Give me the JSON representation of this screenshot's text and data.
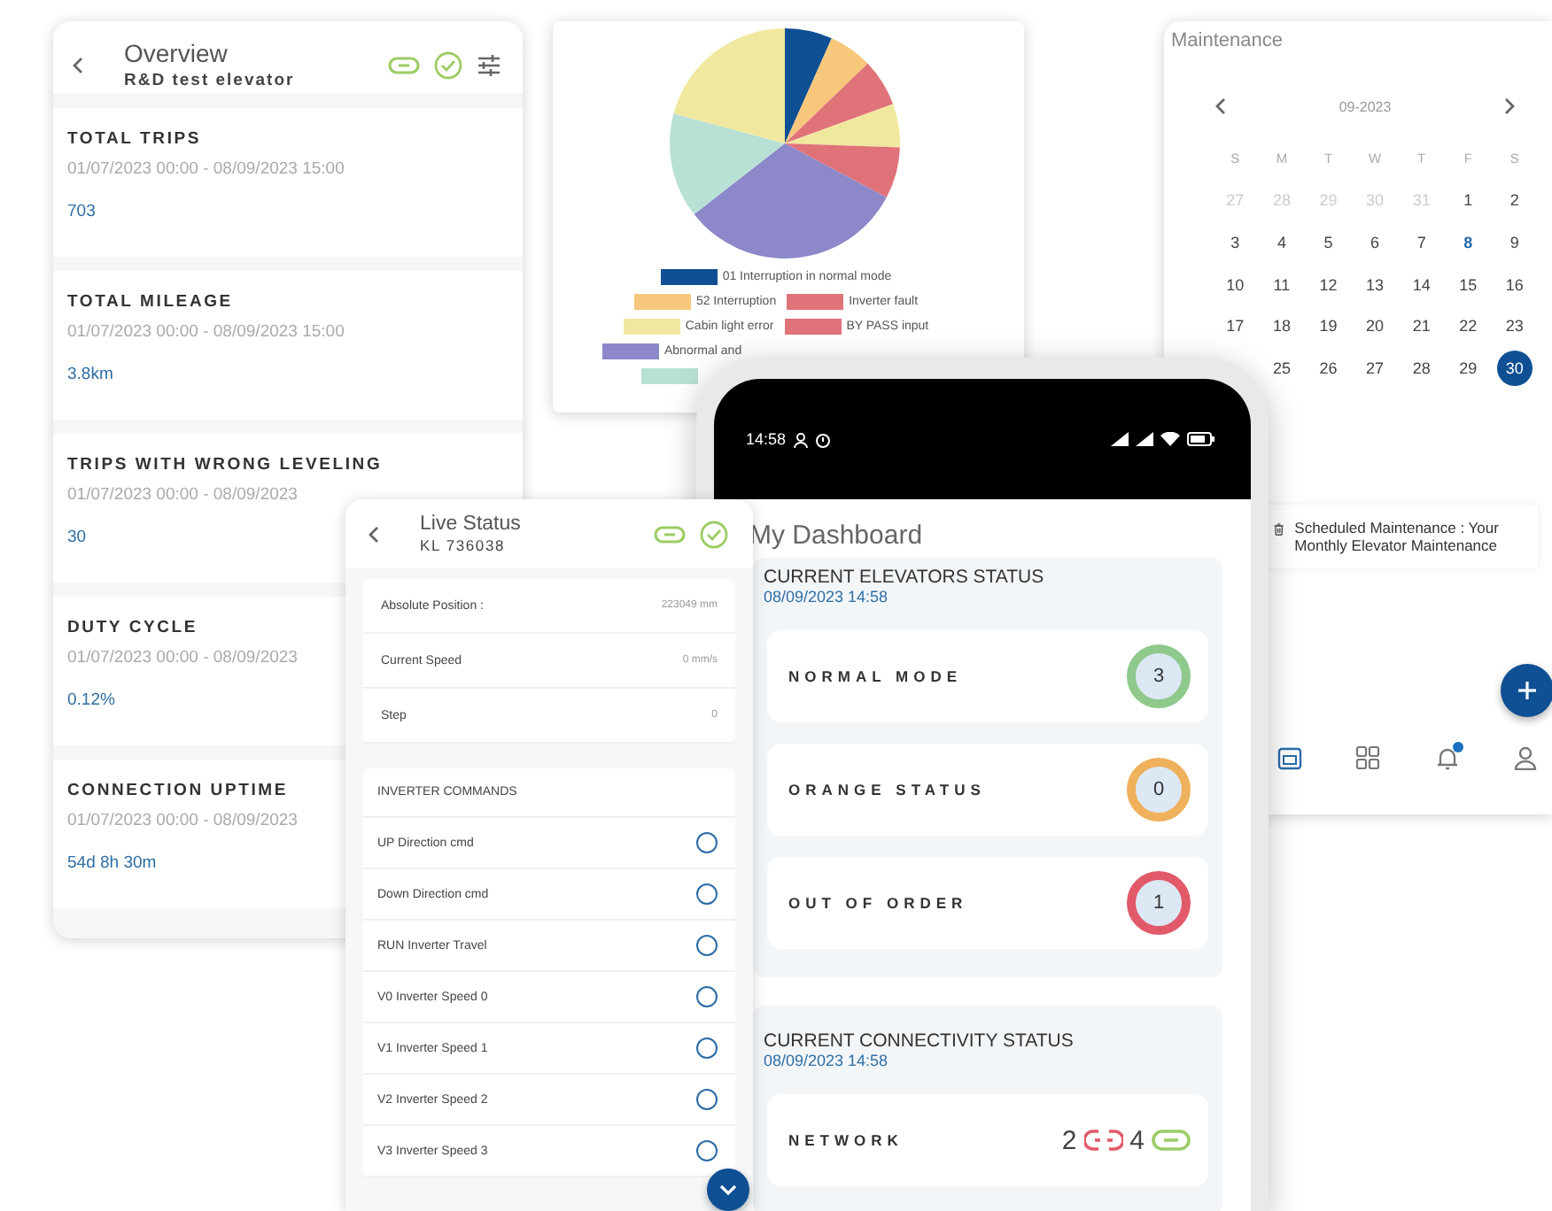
{
  "overview": {
    "title": "Overview",
    "subtitle": "R&D test elevator",
    "metrics": [
      {
        "label": "TOTAL TRIPS",
        "period": "01/07/2023 00:00 - 08/09/2023 15:00",
        "value": "703"
      },
      {
        "label": "TOTAL MILEAGE",
        "period": "01/07/2023 00:00 - 08/09/2023 15:00",
        "value": "3.8km"
      },
      {
        "label": "TRIPS WITH WRONG LEVELING",
        "period": "01/07/2023 00:00 - 08/09/2023",
        "value": "30"
      },
      {
        "label": "DUTY CYCLE",
        "period": "01/07/2023 00:00 - 08/09/2023",
        "value": "0.12%"
      },
      {
        "label": "CONNECTION UPTIME",
        "period": "01/07/2023 00:00 - 08/09/2023",
        "value": "54d 8h 30m"
      }
    ]
  },
  "fault_chart": {
    "legend": [
      {
        "label": "01 Interruption in normal mode",
        "color": "#0f4f93"
      },
      {
        "label": "52 Interruption",
        "color": "#f7c77c"
      },
      {
        "label": "Inverter fault",
        "color": "#e0737a"
      },
      {
        "label": "Cabin light error",
        "color": "#f1e8a0"
      },
      {
        "label": "BY PASS input",
        "color": "#e0737a"
      },
      {
        "label": "Abnormal and",
        "color": "#8c88c9"
      },
      {
        "color": "#b9e0d5"
      }
    ]
  },
  "maintenance": {
    "title": "Maintenance",
    "month": "09-2023",
    "weekdays": [
      "S",
      "M",
      "T",
      "W",
      "T",
      "F",
      "S"
    ],
    "weeks": [
      [
        {
          "day": "27",
          "kind": "outside",
          "selected": false
        },
        {
          "day": "28",
          "kind": "outside",
          "selected": false
        },
        {
          "day": "29",
          "kind": "outside",
          "selected": false
        },
        {
          "day": "30",
          "kind": "outside",
          "selected": false
        },
        {
          "day": "31",
          "kind": "outside",
          "selected": false
        },
        {
          "day": "1",
          "kind": "day",
          "selected": false
        },
        {
          "day": "2",
          "kind": "day",
          "selected": false
        }
      ],
      [
        {
          "day": "3",
          "kind": "day",
          "selected": false
        },
        {
          "day": "4",
          "kind": "day",
          "selected": false
        },
        {
          "day": "5",
          "kind": "day",
          "selected": false
        },
        {
          "day": "6",
          "kind": "day",
          "selected": false
        },
        {
          "day": "7",
          "kind": "day",
          "selected": false
        },
        {
          "day": "8",
          "kind": "event",
          "selected": false
        },
        {
          "day": "9",
          "kind": "day",
          "selected": false
        }
      ],
      [
        {
          "day": "10",
          "kind": "day",
          "selected": false
        },
        {
          "day": "11",
          "kind": "day",
          "selected": false
        },
        {
          "day": "12",
          "kind": "day",
          "selected": false
        },
        {
          "day": "13",
          "kind": "day",
          "selected": false
        },
        {
          "day": "14",
          "kind": "day",
          "selected": false
        },
        {
          "day": "15",
          "kind": "day",
          "selected": false
        },
        {
          "day": "16",
          "kind": "day",
          "selected": false
        }
      ],
      [
        {
          "day": "17",
          "kind": "day",
          "selected": false
        },
        {
          "day": "18",
          "kind": "day",
          "selected": false
        },
        {
          "day": "19",
          "kind": "day",
          "selected": false
        },
        {
          "day": "20",
          "kind": "day",
          "selected": false
        },
        {
          "day": "21",
          "kind": "day",
          "selected": false
        },
        {
          "day": "22",
          "kind": "day",
          "selected": false
        },
        {
          "day": "23",
          "kind": "day",
          "selected": false
        }
      ],
      [
        {
          "day": "25",
          "kind": "day",
          "selected": false
        },
        {
          "day": "26",
          "kind": "day",
          "selected": false
        },
        {
          "day": "27",
          "kind": "day",
          "selected": false
        },
        {
          "day": "28",
          "kind": "day",
          "selected": false
        },
        {
          "day": "29",
          "kind": "day",
          "selected": false
        },
        {
          "day": "30",
          "kind": "day",
          "selected": true
        }
      ]
    ],
    "notification": "Scheduled Maintenance : Your Monthly Elevator Maintenance",
    "nav": [
      {
        "kind": "calendar",
        "selected": true,
        "badge": false
      },
      {
        "kind": "grid",
        "selected": false,
        "badge": false
      },
      {
        "kind": "bell",
        "selected": false,
        "badge": true
      },
      {
        "kind": "person",
        "selected": false,
        "badge": false
      }
    ]
  },
  "live_status": {
    "title": "Live Status",
    "subtitle": "KL 736038",
    "readings": [
      {
        "label": "Absolute Position :",
        "value": "223049 mm"
      },
      {
        "label": "Current Speed",
        "value": "0 mm/s"
      },
      {
        "label": "Step",
        "value": "0"
      }
    ],
    "commands_title": "INVERTER COMMANDS",
    "commands": [
      {
        "label": "UP Direction cmd",
        "selected": false
      },
      {
        "label": "Down Direction cmd",
        "selected": false
      },
      {
        "label": "RUN Inverter Travel",
        "selected": false
      },
      {
        "label": "V0 Inverter Speed 0",
        "selected": false
      },
      {
        "label": "V1 Inverter Speed 1",
        "selected": false
      },
      {
        "label": "V2 Inverter Speed 2",
        "selected": false
      },
      {
        "label": "V3 Inverter Speed 3",
        "selected": false
      }
    ]
  },
  "phone": {
    "time": "14:58",
    "title": "My Dashboard",
    "elevators": {
      "title": "CURRENT ELEVATORS STATUS",
      "timestamp": "08/09/2023 14:58",
      "rows": [
        {
          "label": "NORMAL MODE",
          "count": "3",
          "color": "#8fc98c"
        },
        {
          "label": "ORANGE STATUS",
          "count": "0",
          "color": "#f0b15c"
        },
        {
          "label": "OUT OF ORDER",
          "count": "1",
          "color": "#e25a6a"
        }
      ]
    },
    "connectivity": {
      "title": "CURRENT CONNECTIVITY STATUS",
      "timestamp": "08/09/2023 14:58",
      "rows": [
        {
          "label": "NETWORK",
          "offline": "2",
          "online": "4"
        }
      ]
    }
  }
}
